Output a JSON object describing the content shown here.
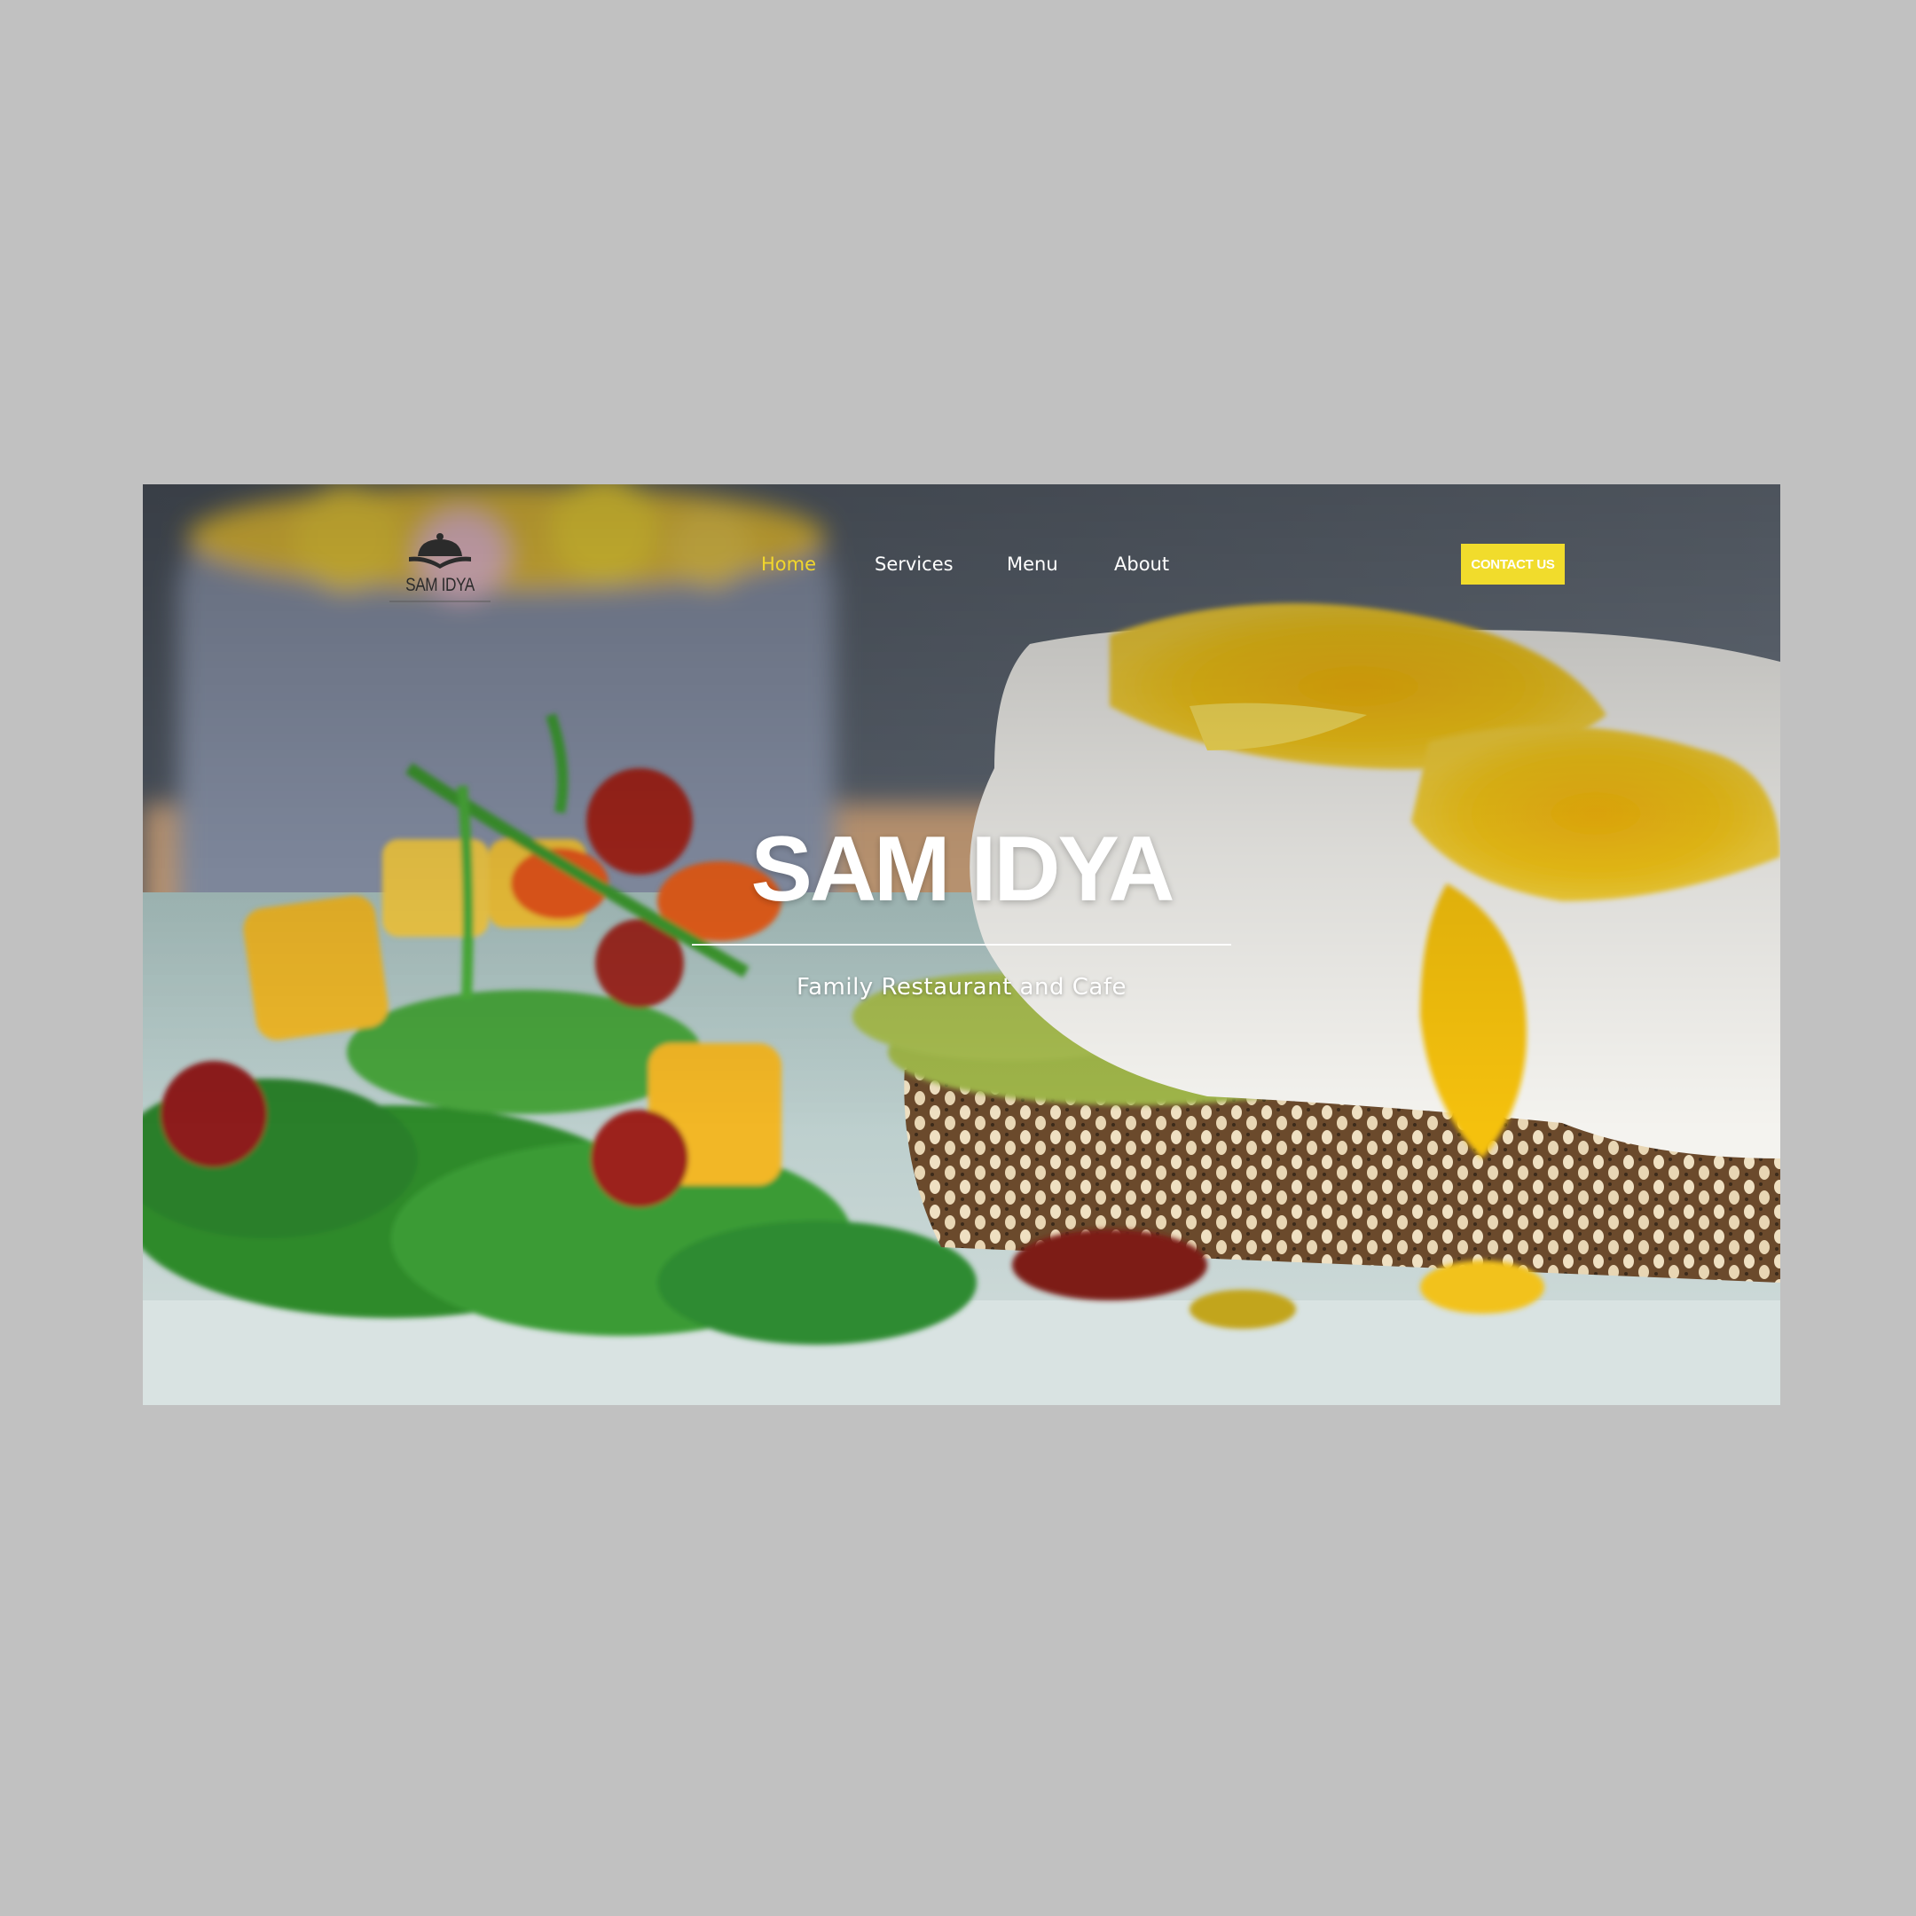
{
  "brand": {
    "logo_text": "SAM IDYA"
  },
  "nav": {
    "items": [
      {
        "label": "Home",
        "active": true
      },
      {
        "label": "Services",
        "active": false
      },
      {
        "label": "Menu",
        "active": false
      },
      {
        "label": "About",
        "active": false
      }
    ],
    "contact_label": "CONTACT US"
  },
  "hero": {
    "title": "SAM IDYA",
    "subtitle": "Family Restaurant and Cafe"
  },
  "colors": {
    "accent": "#f1dc2c",
    "page_background": "#c1c1c1",
    "text_on_hero": "#ffffff"
  },
  "icons": {
    "logo_icon": "cloche-on-book-icon"
  }
}
